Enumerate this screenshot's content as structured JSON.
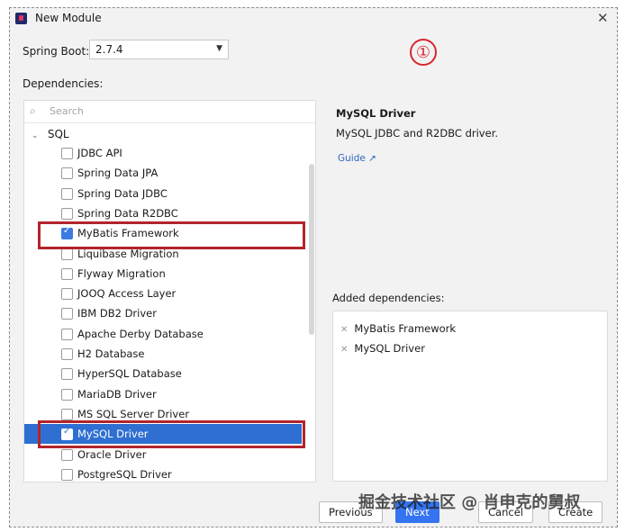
{
  "window": {
    "title": "New Module",
    "close_glyph": "✕"
  },
  "spring_boot": {
    "label": "Spring Boot:",
    "value": "2.7.4"
  },
  "step_marker": "①",
  "dependencies": {
    "label": "Dependencies:",
    "search_placeholder": "Search",
    "group": "SQL",
    "items": [
      {
        "label": "JDBC API",
        "checked": false
      },
      {
        "label": "Spring Data JPA",
        "checked": false
      },
      {
        "label": "Spring Data JDBC",
        "checked": false
      },
      {
        "label": "Spring Data R2DBC",
        "checked": false
      },
      {
        "label": "MyBatis Framework",
        "checked": true
      },
      {
        "label": "Liquibase Migration",
        "checked": false
      },
      {
        "label": "Flyway Migration",
        "checked": false
      },
      {
        "label": "JOOQ Access Layer",
        "checked": false
      },
      {
        "label": "IBM DB2 Driver",
        "checked": false
      },
      {
        "label": "Apache Derby Database",
        "checked": false
      },
      {
        "label": "H2 Database",
        "checked": false
      },
      {
        "label": "HyperSQL Database",
        "checked": false
      },
      {
        "label": "MariaDB Driver",
        "checked": false
      },
      {
        "label": "MS SQL Server Driver",
        "checked": false
      },
      {
        "label": "MySQL Driver",
        "checked": true,
        "selected": true
      },
      {
        "label": "Oracle Driver",
        "checked": false
      },
      {
        "label": "PostgreSQL Driver",
        "checked": false
      }
    ]
  },
  "info": {
    "title": "MySQL Driver",
    "description": "MySQL JDBC and R2DBC driver.",
    "guide": "Guide ↗"
  },
  "added": {
    "label": "Added dependencies:",
    "items": [
      "MyBatis Framework",
      "MySQL Driver"
    ]
  },
  "buttons": {
    "previous": "Previous",
    "next": "Next",
    "cancel": "Cancel",
    "create": "Create"
  },
  "watermark": "掘金技术社区 @ 肖申克的舅叔",
  "colors": {
    "selection": "#2e6fd1",
    "highlight_box": "#b3242a",
    "primary_button": "#3574f0"
  }
}
